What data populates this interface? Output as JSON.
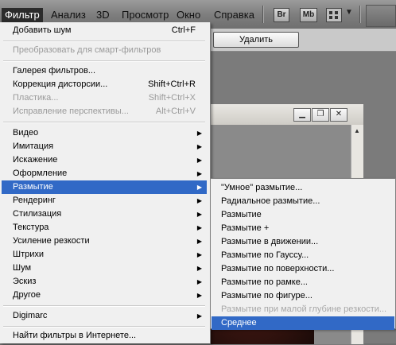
{
  "menubar": {
    "items": [
      {
        "label": "Фильтр",
        "active": true
      },
      {
        "label": "Анализ"
      },
      {
        "label": "3D"
      },
      {
        "label": "Просмотр"
      },
      {
        "label": "Окно"
      },
      {
        "label": "Справка"
      }
    ],
    "icons": {
      "bridge": "Br",
      "mini_bridge": "Mb"
    }
  },
  "options": {
    "delete_button": "Удалить"
  },
  "filter_menu": {
    "add_noise": {
      "label": "Добавить шум",
      "shortcut": "Ctrl+F"
    },
    "convert_smart": {
      "label": "Преобразовать для смарт-фильтров"
    },
    "gallery": {
      "label": "Галерея фильтров..."
    },
    "lens_correction": {
      "label": "Коррекция дисторсии...",
      "shortcut": "Shift+Ctrl+R"
    },
    "liquify": {
      "label": "Пластика...",
      "shortcut": "Shift+Ctrl+X"
    },
    "vanishing_point": {
      "label": "Исправление перспективы...",
      "shortcut": "Alt+Ctrl+V"
    },
    "submenus": [
      "Видео",
      "Имитация",
      "Искажение",
      "Оформление",
      "Размытие",
      "Рендеринг",
      "Стилизация",
      "Текстура",
      "Усиление резкости",
      "Штрихи",
      "Шум",
      "Эскиз",
      "Другое"
    ],
    "digimarc": "Digimarc",
    "browse_online": "Найти фильтры в Интернете..."
  },
  "blur_submenu": {
    "items": [
      {
        "label": "\"Умное\" размытие..."
      },
      {
        "label": "Радиальное размытие..."
      },
      {
        "label": "Размытие"
      },
      {
        "label": "Размытие +"
      },
      {
        "label": "Размытие в движении..."
      },
      {
        "label": "Размытие по Гауссу..."
      },
      {
        "label": "Размытие по поверхности..."
      },
      {
        "label": "Размытие по рамке..."
      },
      {
        "label": "Размытие по фигуре..."
      },
      {
        "label": "Размытие при малой глубине резкости...",
        "disabled": true
      },
      {
        "label": "Среднее",
        "highlighted": true
      }
    ]
  },
  "colors": {
    "highlight": "#3169c6",
    "menu_bg": "#f0f0f0"
  }
}
